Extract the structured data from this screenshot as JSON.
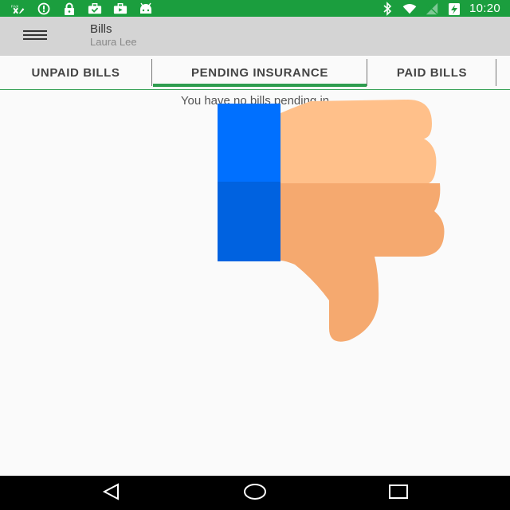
{
  "status_bar": {
    "time": "10:20",
    "icons_left": [
      "fax-icon",
      "alert-circle-icon",
      "lock-icon",
      "briefcase-check-icon",
      "play-store-icon",
      "android-icon"
    ],
    "icons_right": [
      "bluetooth-icon",
      "wifi-icon",
      "no-signal-icon",
      "battery-charging-icon"
    ],
    "color": "#1b9e3e"
  },
  "app_bar": {
    "title": "Bills",
    "subtitle": "Laura Lee"
  },
  "tabs": [
    {
      "label": "UNPAID BILLS",
      "selected": false
    },
    {
      "label": "PENDING INSURANCE",
      "selected": true
    },
    {
      "label": "PAID BILLS",
      "selected": false
    }
  ],
  "content": {
    "empty_message": "You have no bills pending in"
  },
  "overlay": {
    "icon": "thumbs-down-icon"
  },
  "nav_bar": {
    "icons": [
      "back-icon",
      "home-icon",
      "recents-icon"
    ]
  }
}
